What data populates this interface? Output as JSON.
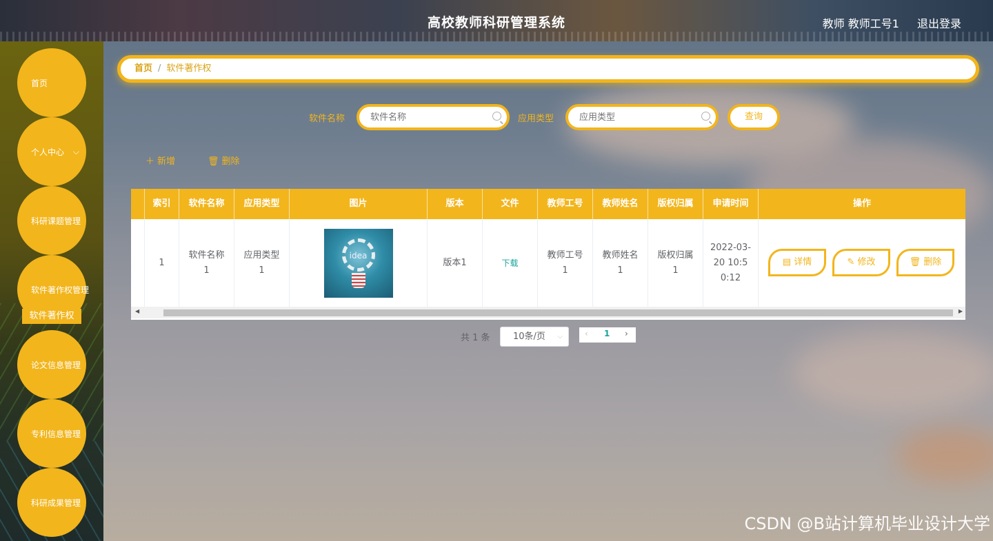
{
  "header": {
    "title": "高校教师科研管理系统",
    "user": "教师 教师工号1",
    "logout": "退出登录"
  },
  "sidebar": {
    "items": [
      {
        "label": "首页"
      },
      {
        "label": "个人中心"
      },
      {
        "label": "科研课题管理"
      },
      {
        "label": "软件著作权管理"
      },
      {
        "label": "论文信息管理"
      },
      {
        "label": "专利信息管理"
      },
      {
        "label": "科研成果管理"
      }
    ],
    "sub_item": "软件著作权"
  },
  "breadcrumb": {
    "home": "首页",
    "separator": "/",
    "current": "软件著作权"
  },
  "search": {
    "name_label": "软件名称",
    "name_placeholder": "软件名称",
    "type_label": "应用类型",
    "type_placeholder": "应用类型",
    "query_button": "查询"
  },
  "actions": {
    "add": "新增",
    "delete": "删除"
  },
  "table": {
    "columns": [
      "索引",
      "软件名称",
      "应用类型",
      "图片",
      "版本",
      "文件",
      "教师工号",
      "教师姓名",
      "版权归属",
      "申请时间",
      "操作"
    ],
    "rows": [
      {
        "index": "1",
        "name": "软件名称1",
        "type": "应用类型1",
        "image_text": "idea",
        "version": "版本1",
        "file": "下载",
        "teacher_id": "教师工号1",
        "teacher_name": "教师姓名1",
        "copyright": "版权归属1",
        "date": "2022-03-20 10:50:12",
        "btn_detail": "详情",
        "btn_edit": "修改",
        "btn_delete": "删除"
      }
    ]
  },
  "pagination": {
    "total": "共 1 条",
    "page_size": "10条/页",
    "current_page": "1"
  },
  "watermark": "CSDN @B站计算机毕业设计大学",
  "colors": {
    "accent": "#f2b51c",
    "link": "#1aa39a"
  }
}
